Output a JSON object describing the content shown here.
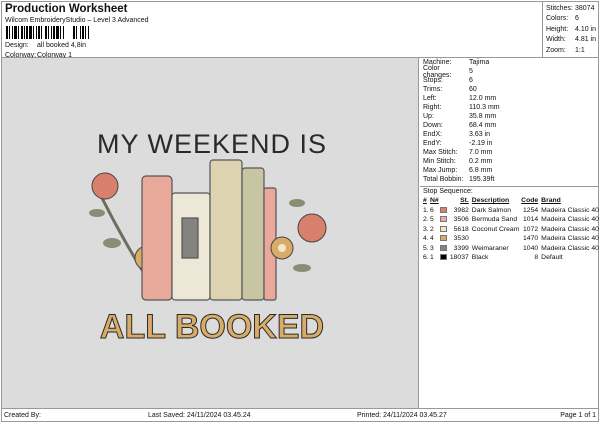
{
  "header": {
    "title": "Production Worksheet",
    "subtitle": "Wilcom EmbroideryStudio – Level 3 Advanced",
    "design_label": "Design:",
    "design_value": "all booked 4,8in",
    "colorway_label": "Colorway:",
    "colorway_value": "Colorway 1"
  },
  "stats": [
    {
      "label": "Stitches:",
      "value": "38074"
    },
    {
      "label": "Colors:",
      "value": "6"
    },
    {
      "label": "Height:",
      "value": "4.10 in"
    },
    {
      "label": "Width:",
      "value": "4.81 in"
    },
    {
      "label": "Zoom:",
      "value": "1:1"
    }
  ],
  "design": {
    "line1": "MY WEEKEND IS",
    "line2": "ALL BOOKED"
  },
  "details": [
    {
      "label": "Machine:",
      "value": "Tajima"
    },
    {
      "label": "Color changes:",
      "value": "5"
    },
    {
      "label": "Stops:",
      "value": "6"
    },
    {
      "label": "Trims:",
      "value": "60"
    },
    {
      "label": "Left:",
      "value": "12.0 mm"
    },
    {
      "label": "Right:",
      "value": "110.3 mm"
    },
    {
      "label": "Up:",
      "value": "35.8 mm"
    },
    {
      "label": "Down:",
      "value": "68.4 mm"
    },
    {
      "label": "EndX:",
      "value": "3.63 in"
    },
    {
      "label": "EndY:",
      "value": "-2.19 in"
    },
    {
      "label": "Max Stitch:",
      "value": "7.0 mm"
    },
    {
      "label": "Min Stitch:",
      "value": "0.2 mm"
    },
    {
      "label": "Max Jump:",
      "value": "6.8 mm"
    },
    {
      "label": "Total Bobbin:",
      "value": "195.39ft"
    }
  ],
  "stop_sequence": {
    "title": "Stop Sequence:",
    "headers": [
      "#",
      "N#",
      "",
      "St.",
      "Description",
      "Code",
      "Brand"
    ],
    "rows": [
      {
        "n": "1.",
        "needle": "6",
        "color": "#d9806c",
        "st": "3982",
        "desc": "Dark Salmon",
        "code": "1254",
        "brand": "Madeira Classic 40"
      },
      {
        "n": "2.",
        "needle": "5",
        "color": "#f0a6aa",
        "st": "3506",
        "desc": "Bermuda Sand",
        "code": "1014",
        "brand": "Madeira Classic 40"
      },
      {
        "n": "3.",
        "needle": "2",
        "color": "#f4e6cc",
        "st": "5618",
        "desc": "Coconut Cream",
        "code": "1072",
        "brand": "Madeira Classic 40"
      },
      {
        "n": "4.",
        "needle": "4",
        "color": "#d8ac68",
        "st": "3530",
        "desc": "",
        "code": "1470",
        "brand": "Madeira Classic 40"
      },
      {
        "n": "5.",
        "needle": "3",
        "color": "#858380",
        "st": "3399",
        "desc": "Weimaraner",
        "code": "1040",
        "brand": "Madeira Classic 40"
      },
      {
        "n": "6.",
        "needle": "1",
        "color": "#000000",
        "st": "18037",
        "desc": "Black",
        "code": "8",
        "brand": "Default"
      }
    ]
  },
  "footer": {
    "created": "Created By:",
    "saved": "Last Saved: 24/11/2024 03.45.24",
    "printed": "Printed: 24/11/2024 03.45.27",
    "page": "Page 1 of 1"
  }
}
